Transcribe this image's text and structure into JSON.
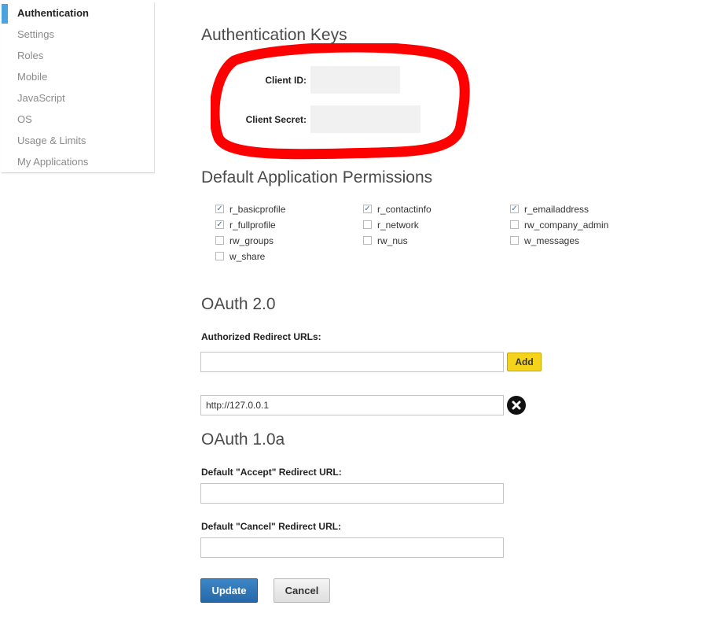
{
  "sidebar": {
    "items": [
      {
        "label": "Authentication",
        "active": true
      },
      {
        "label": "Settings"
      },
      {
        "label": "Roles"
      },
      {
        "label": "Mobile"
      },
      {
        "label": "JavaScript"
      },
      {
        "label": "OS"
      },
      {
        "label": "Usage & Limits"
      },
      {
        "label": "My Applications"
      }
    ]
  },
  "auth_keys": {
    "heading": "Authentication Keys",
    "client_id_label": "Client ID:",
    "client_id_value": "",
    "client_secret_label": "Client Secret:",
    "client_secret_value": ""
  },
  "permissions": {
    "heading": "Default Application Permissions",
    "items": [
      {
        "label": "r_basicprofile",
        "checked": true
      },
      {
        "label": "r_contactinfo",
        "checked": true
      },
      {
        "label": "r_emailaddress",
        "checked": true
      },
      {
        "label": "r_fullprofile",
        "checked": true
      },
      {
        "label": "r_network",
        "checked": false
      },
      {
        "label": "rw_company_admin",
        "checked": false
      },
      {
        "label": "rw_groups",
        "checked": false
      },
      {
        "label": "rw_nus",
        "checked": false
      },
      {
        "label": "w_messages",
        "checked": false
      },
      {
        "label": "w_share",
        "checked": false
      }
    ]
  },
  "oauth2": {
    "heading": "OAuth 2.0",
    "redirect_label": "Authorized Redirect URLs:",
    "new_url_value": "",
    "add_label": "Add",
    "urls": [
      "http://127.0.0.1"
    ]
  },
  "oauth1": {
    "heading": "OAuth 1.0a",
    "accept_label": "Default \"Accept\" Redirect URL:",
    "accept_value": "",
    "cancel_label": "Default \"Cancel\" Redirect URL:",
    "cancel_value": ""
  },
  "actions": {
    "update_label": "Update",
    "cancel_label": "Cancel"
  },
  "colors": {
    "accent": "#4ba3e0",
    "highlight": "#ff0000",
    "add_button": "#f5d31d",
    "update_button": "#2e74b5"
  },
  "icons": {
    "remove": "close-circle-icon",
    "check": "checkmark-icon"
  }
}
